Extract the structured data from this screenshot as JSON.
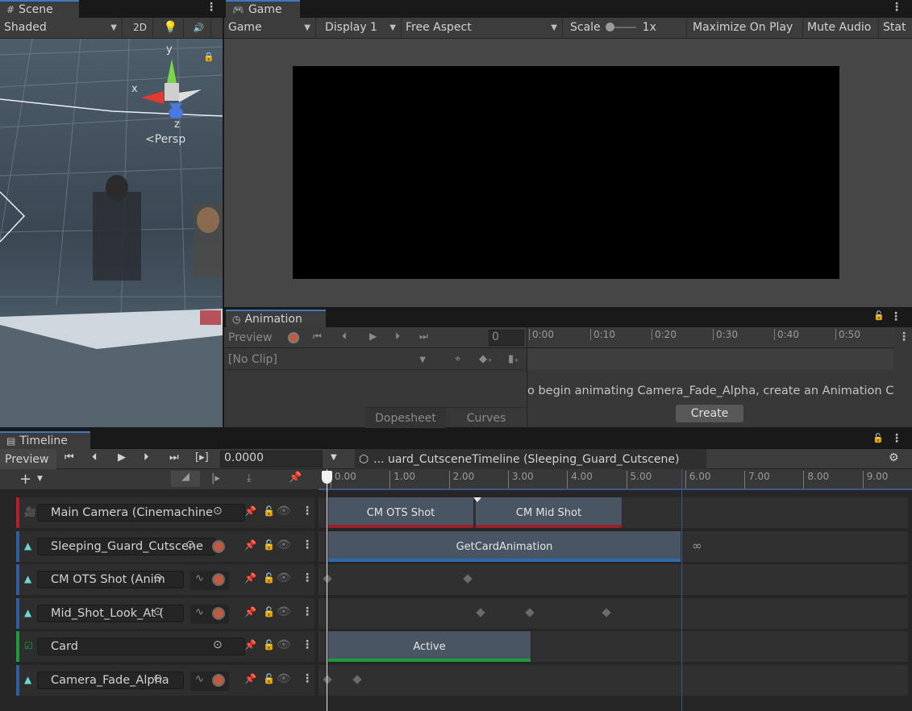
{
  "scene": {
    "tab_label": "Scene",
    "shading_mode": "Shaded",
    "mode_2d": "2D",
    "gizmo": {
      "y": "y",
      "x": "x",
      "z": "z",
      "persp": "<Persp"
    }
  },
  "game": {
    "tab_label": "Game",
    "view": "Game",
    "display": "Display 1",
    "aspect": "Free Aspect",
    "scale_label": "Scale",
    "scale_value": "1x",
    "maximize": "Maximize On Play",
    "mute": "Mute Audio",
    "stats": "Stat"
  },
  "animation": {
    "tab_label": "Animation",
    "preview": "Preview",
    "frame": "0",
    "clip": "[No Clip]",
    "ruler": [
      "0:00",
      "0:10",
      "0:20",
      "0:30",
      "0:40",
      "0:50"
    ],
    "message": "o begin animating Camera_Fade_Alpha, create an Animation Clip",
    "create_button": "Create",
    "tab_dopesheet": "Dopesheet",
    "tab_curves": "Curves"
  },
  "timeline": {
    "tab_label": "Timeline",
    "preview": "Preview",
    "time": "0.0000",
    "asset_path": "... uard_CutsceneTimeline (Sleeping_Guard_Cutscene)",
    "ruler": [
      "0.00",
      "1.00",
      "2.00",
      "3.00",
      "4.00",
      "5.00",
      "6.00",
      "7.00",
      "8.00",
      "9.00"
    ],
    "tracks": [
      {
        "name": "Main Camera (Cinemachine",
        "color": "#b2202a"
      },
      {
        "name": "Sleeping_Guard_Cutscene",
        "color": "#2f5f9e"
      },
      {
        "name": "CM OTS Shot (Anim",
        "color": "#2f5f9e"
      },
      {
        "name": "Mid_Shot_Look_At (",
        "color": "#2f5f9e"
      },
      {
        "name": "Card",
        "color": "#1e9a3a"
      },
      {
        "name": "Camera_Fade_Alpha",
        "color": "#2f5f9e"
      }
    ],
    "clips": {
      "cm_ots": "CM OTS Shot",
      "cm_mid": "CM Mid Shot",
      "get_card": "GetCardAnimation",
      "active": "Active"
    }
  }
}
